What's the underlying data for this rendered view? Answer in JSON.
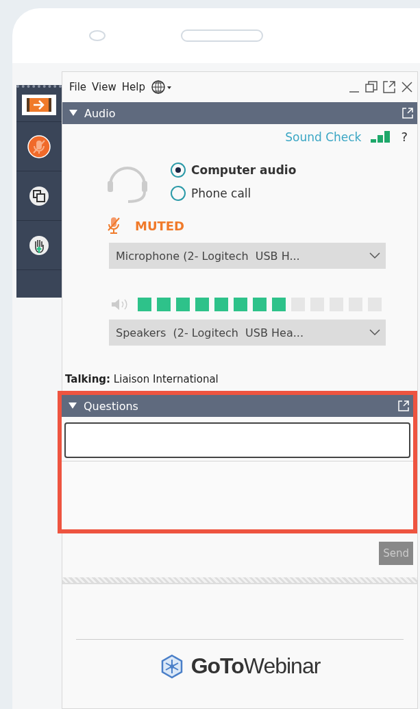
{
  "menu": [
    "File",
    "View",
    "Help"
  ],
  "sidebar": [
    {
      "kind": "arrow",
      "selected": true
    },
    {
      "kind": "mic",
      "selected": false
    },
    {
      "kind": "screens",
      "selected": false
    },
    {
      "kind": "hand",
      "selected": false
    }
  ],
  "audio": {
    "title": "Audio",
    "sound_check": "Sound Check",
    "help": "?",
    "options": [
      {
        "label": "Computer audio",
        "selected": true
      },
      {
        "label": "Phone call",
        "selected": false
      }
    ],
    "status": "MUTED",
    "microphone": "Microphone (2- Logitech  USB H...",
    "speaker_meter": {
      "level": 0.615
    },
    "speakers": "Speakers  (2- Logitech  USB Hea...",
    "talking": "**Talking:** Liaison International"
  },
  "questions": {
    "title": "Questions",
    "send": "Send"
  },
  "logo": "**GoTo**Webinar"
}
